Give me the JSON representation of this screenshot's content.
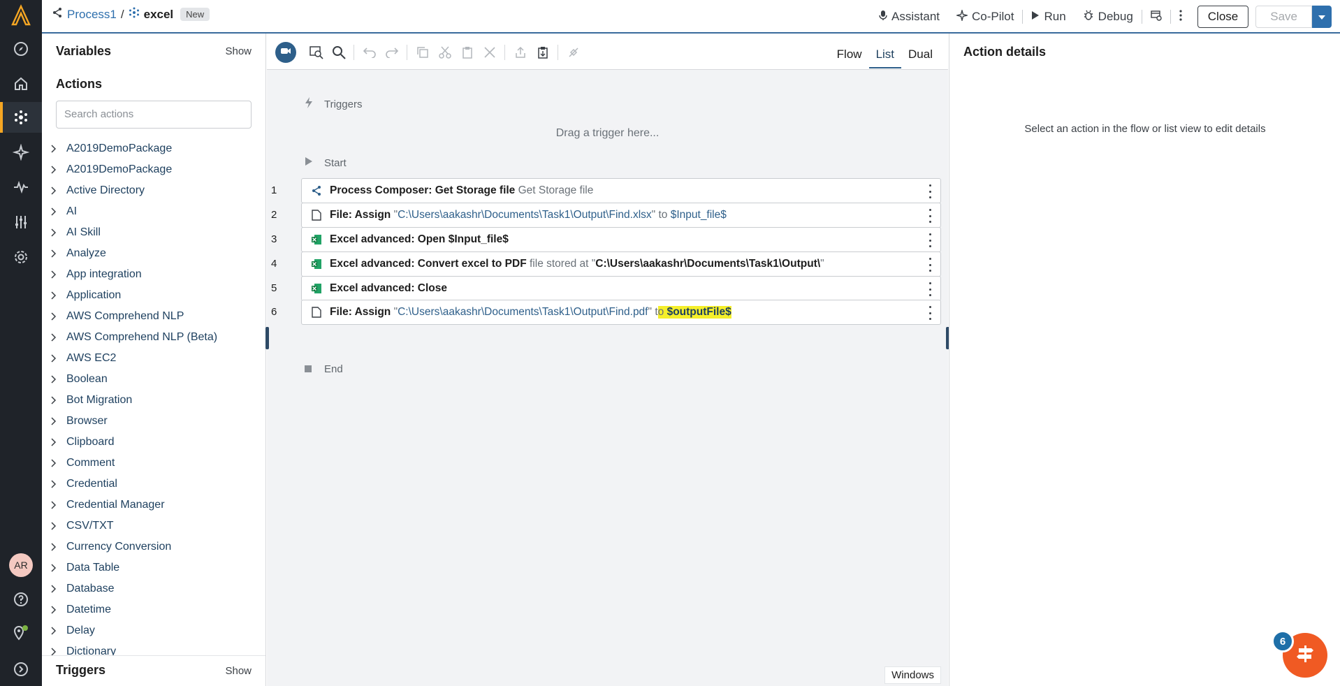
{
  "header": {
    "process_name": "Process1",
    "separator": "/",
    "bot_name": "excel",
    "badge": "New",
    "assistant": "Assistant",
    "copilot": "Co-Pilot",
    "run": "Run",
    "debug": "Debug",
    "close": "Close",
    "save": "Save"
  },
  "rail": {
    "avatar_initials": "AR",
    "icons": [
      "logo-icon",
      "explore-icon",
      "home-icon",
      "automation-icon",
      "ai-icon",
      "activity-icon",
      "manage-icon",
      "settings-icon",
      "help-icon",
      "location-icon",
      "expand-icon"
    ]
  },
  "left_panel": {
    "variables_title": "Variables",
    "variables_show": "Show",
    "actions_title": "Actions",
    "search_placeholder": "Search actions",
    "actions": [
      "A2019DemoPackage",
      "A2019DemoPackage",
      "Active Directory",
      "AI",
      "AI Skill",
      "Analyze",
      "App integration",
      "Application",
      "AWS Comprehend NLP",
      "AWS Comprehend NLP (Beta)",
      "AWS EC2",
      "Boolean",
      "Bot Migration",
      "Browser",
      "Clipboard",
      "Comment",
      "Credential",
      "Credential Manager",
      "CSV/TXT",
      "Currency Conversion",
      "Data Table",
      "Database",
      "Datetime",
      "Delay",
      "Dictionary"
    ],
    "triggers_title": "Triggers",
    "triggers_show": "Show"
  },
  "editor": {
    "views": [
      "Flow",
      "List",
      "Dual"
    ],
    "active_view": "List",
    "triggers_label": "Triggers",
    "drag_hint": "Drag a trigger here...",
    "start_label": "Start",
    "end_label": "End",
    "platform_tag": "Windows",
    "steps": [
      {
        "num": "1",
        "icon": "process-composer-icon",
        "title": "Process Composer: Get Storage file",
        "detail": "Get Storage file"
      },
      {
        "num": "2",
        "icon": "file-icon",
        "title": "File: Assign",
        "q1": "\"",
        "path": "C:\\Users\\aakashr\\Documents\\Task1\\Output\\Find.xlsx",
        "q2": "\"",
        "to": "to",
        "var": "$Input_file$"
      },
      {
        "num": "3",
        "icon": "excel-icon",
        "title": "Excel advanced: Open $Input_file$"
      },
      {
        "num": "4",
        "icon": "excel-icon",
        "title": "Excel advanced: Convert excel to PDF",
        "mid": "file stored at",
        "q1": "\"",
        "path": "C:\\Users\\aakashr\\Documents\\Task1\\Output\\",
        "q2": "\""
      },
      {
        "num": "5",
        "icon": "excel-icon",
        "title": "Excel advanced: Close"
      },
      {
        "num": "6",
        "icon": "file-icon",
        "title": "File: Assign",
        "q1": "\"",
        "path": "C:\\Users\\aakashr\\Documents\\Task1\\Output\\Find.pdf",
        "q2": "\"",
        "to_a": "t",
        "to_b": "o",
        "var": "$outputFile$"
      }
    ]
  },
  "right_panel": {
    "title": "Action details",
    "message": "Select an action in the flow or list view to edit details"
  },
  "fab": {
    "badge_count": "6"
  },
  "colors": {
    "accent": "#2e5f8a",
    "rail": "#1f2329",
    "active_rail": "#f5a623",
    "fab": "#f05a23",
    "highlight": "#f5ef2a"
  }
}
